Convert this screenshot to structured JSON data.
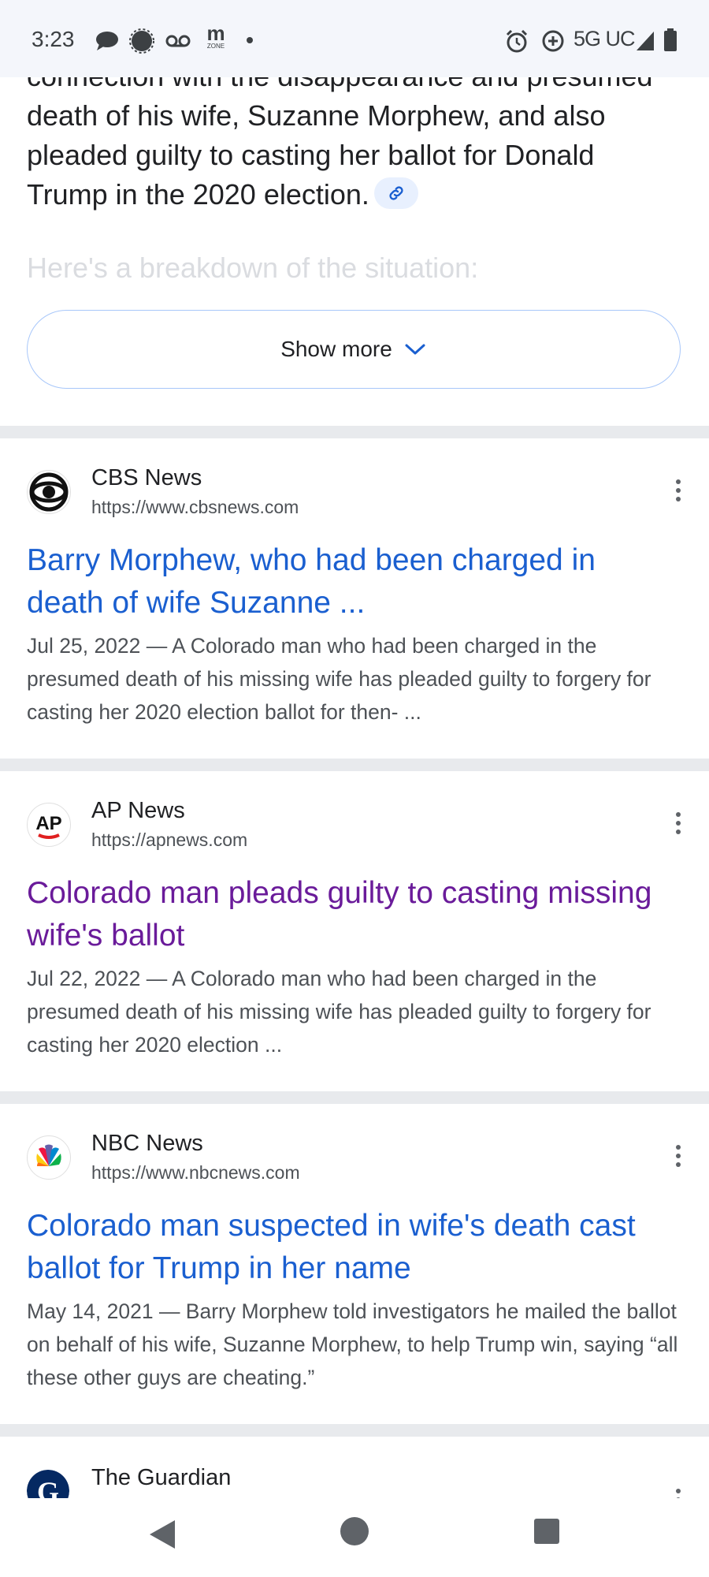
{
  "status_bar": {
    "time": "3:23",
    "network": "5G UC",
    "icons": [
      "chat-bubble-icon",
      "messenger-icon",
      "voicemail-icon",
      "m-zone-icon",
      "dot-icon",
      "alarm-icon",
      "data-saver-icon",
      "signal-icon",
      "battery-icon"
    ],
    "m_zone_label": "ZONE"
  },
  "overview": {
    "text_partial": "connection with the disappearance and presumed death of his wife, Suzanne Morphew, and also pleaded guilty to casting her ballot for Donald Trump in the 2020 election.",
    "faded_text": "Here's a breakdown of the situation:",
    "show_more_label": "Show more"
  },
  "results": [
    {
      "site_name": "CBS News",
      "url": "https://www.cbsnews.com",
      "title": "Barry Morphew, who had been charged in death of wife Suzanne ...",
      "snippet": "Jul 25, 2022 — A Colorado man who had been charged in the presumed death of his missing wife has pleaded guilty to forgery for casting her 2020 election ballot for then- ...",
      "visited": false,
      "favicon": "cbs-eye-icon"
    },
    {
      "site_name": "AP News",
      "url": "https://apnews.com",
      "title": "Colorado man pleads guilty to casting missing wife's ballot",
      "snippet": "Jul 22, 2022 — A Colorado man who had been charged in the presumed death of his missing wife has pleaded guilty to forgery for casting her 2020 election ...",
      "visited": true,
      "favicon": "ap-logo-icon",
      "favicon_text": "AP"
    },
    {
      "site_name": "NBC News",
      "url": "https://www.nbcnews.com",
      "title": "Colorado man suspected in wife's death cast ballot for Trump in her name",
      "snippet": "May 14, 2021 — Barry Morphew told investigators he mailed the ballot on behalf of his wife, Suzanne Morphew, to help Trump win, saying “all these other guys are cheating.”",
      "visited": false,
      "favicon": "nbc-peacock-icon"
    },
    {
      "site_name": "The Guardian",
      "favicon": "guardian-g-icon"
    }
  ],
  "colors": {
    "link_blue": "#1a5fd0",
    "link_visited": "#6a1b9a",
    "divider": "#e8eaed",
    "chip_bg": "#e8f0fe"
  }
}
